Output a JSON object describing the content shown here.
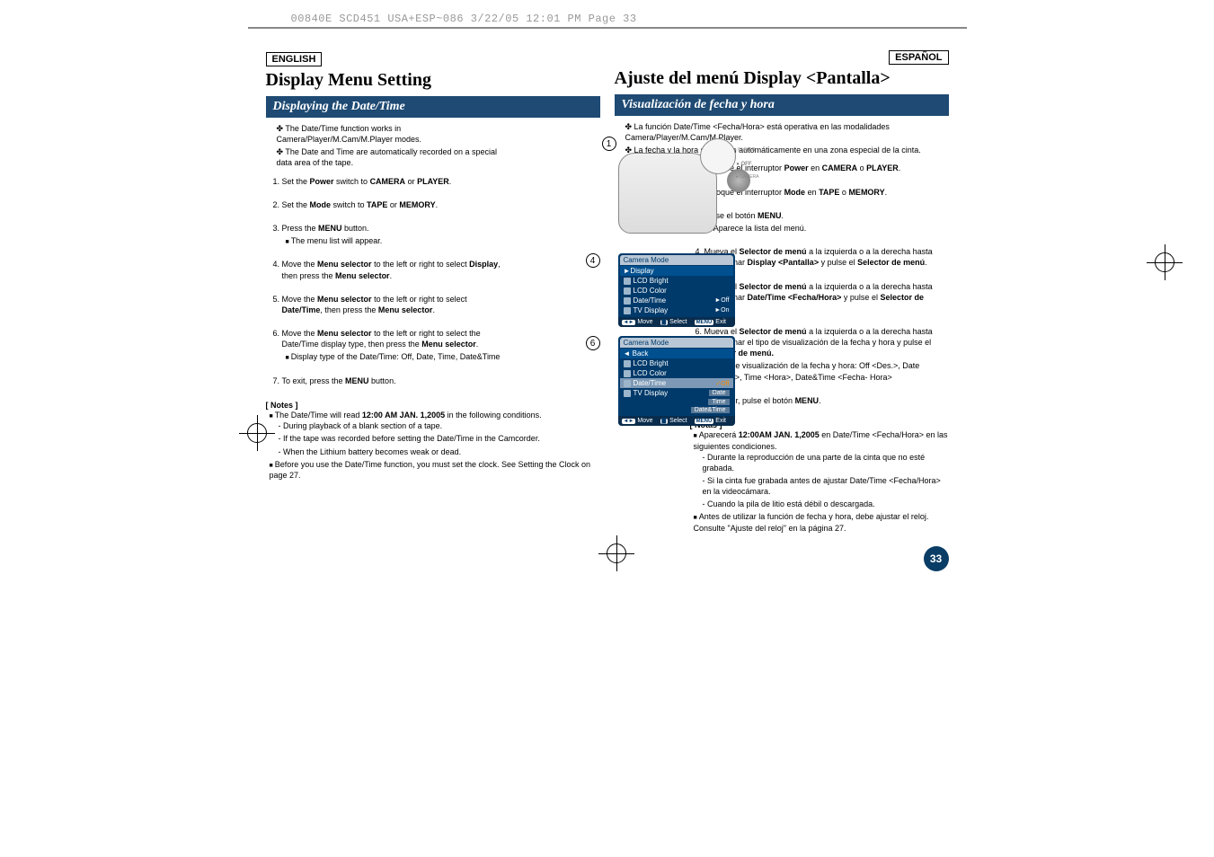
{
  "print_header": "00840E SCD451 USA+ESP~086  3/22/05 12:01 PM  Page 33",
  "left": {
    "lang": "ENGLISH",
    "title": "Display Menu Setting",
    "subtitle": "Displaying the Date/Time",
    "intro": [
      "The Date/Time function works in Camera/Player/M.Cam/M.Player modes.",
      "The Date and Time are automatically recorded on a special data area of the tape."
    ],
    "steps": [
      {
        "text": "Set the <strong>Power</strong> switch to <strong>CAMERA</strong> or <strong>PLAYER</strong>."
      },
      {
        "text": "Set the <strong>Mode</strong> switch to <strong>TAPE</strong> or <strong>MEMORY</strong>."
      },
      {
        "text": "Press the <strong>MENU</strong> button.",
        "subs": [
          "The menu list will appear."
        ]
      },
      {
        "text": "Move the <strong>Menu selector</strong> to the left or right to select <strong>Display</strong>, then press the <strong>Menu selector</strong>."
      },
      {
        "text": "Move the <strong>Menu selector</strong> to the left or right to select <strong>Date/Time</strong>, then press the <strong>Menu selector</strong>."
      },
      {
        "text": "Move the <strong>Menu selector</strong> to the left or right to select the Date/Time display type, then press the <strong>Menu selector</strong>.",
        "subs": [
          "Display type of the Date/Time: Off, Date, Time, Date&Time"
        ]
      },
      {
        "text": "To exit, press the <strong>MENU</strong> button."
      }
    ],
    "notes_head": "[ Notes ]",
    "notes": [
      {
        "text": "The Date/Time will read <strong>12:00 AM JAN. 1,2005</strong> in the following conditions.",
        "dashes": [
          "During playback of a blank section of a tape.",
          "If the tape was recorded before setting the Date/Time in the Camcorder.",
          "When the Lithium battery becomes weak or dead."
        ]
      },
      {
        "text": "Before you use the Date/Time function, you must set the clock. See Setting the Clock on page 27."
      }
    ]
  },
  "right": {
    "lang": "ESPAÑOL",
    "title": "Ajuste del menú Display <Pantalla>",
    "subtitle": "Visualización de fecha y hora",
    "intro": [
      "La función Date/Time <Fecha/Hora> está operativa en las modalidades Camera/Player/M.Cam/M.Player.",
      "La fecha y la hora se graban automáticamente en una zona especial de la cinta."
    ],
    "steps": [
      {
        "text": "Coloque el interruptor <strong>Power</strong> en <strong>CAMERA</strong> o <strong>PLAYER</strong>."
      },
      {
        "text": "Coloque el interruptor <strong>Mode</strong> en <strong>TAPE</strong> o <strong>MEMORY</strong>."
      },
      {
        "text": "Pulse el botón <strong>MENU</strong>.",
        "subs": [
          "Aparece la lista del menú."
        ]
      },
      {
        "text": "Mueva el <strong>Selector de menú</strong> a la izquierda o a la derecha hasta seleccionar <strong>Display &lt;Pantalla&gt;</strong> y pulse el <strong>Selector de menú</strong>."
      },
      {
        "text": "Mueva el <strong>Selector de menú</strong> a la izquierda o a la derecha hasta seleccionar <strong>Date/Time &lt;Fecha/Hora&gt;</strong> y pulse el <strong>Selector de menú</strong>."
      },
      {
        "text": "Mueva el <strong>Selector de menú</strong> a la izquierda o a la derecha hasta seleccionar el tipo de visualización de la fecha y hora y pulse el <strong>Selector de menú.</strong>",
        "subs": [
          "Tipo de visualización de la fecha y hora: Off <Des.>, Date <Fecha>, Time <Hora>, Date&Time <Fecha- Hora>"
        ]
      },
      {
        "text": "Para salir, pulse el botón <strong>MENU</strong>."
      }
    ],
    "notes_head": "[ Notas ]",
    "notes": [
      {
        "text": "Aparecerá <strong>12:00AM JAN. 1,2005</strong> en Date/Time &lt;Fecha/Hora&gt; en las siguientes condiciones.",
        "dashes": [
          "Durante la reproducción de una parte de la cinta que no esté grabada.",
          "Si la cinta fue grabada antes de ajustar Date/Time <Fecha/Hora> en la videocámara.",
          "Cuando la pila de litio está débil o descargada."
        ]
      },
      {
        "text": "Antes de utilizar la función de fecha y hora, debe ajustar el reloj. Consulte \"Ajuste del reloj\" en la página 27."
      }
    ]
  },
  "camera_labels": {
    "player": "PLAYER",
    "off": "OFF",
    "camera": "CAMERA"
  },
  "menu4": {
    "title": "Camera Mode",
    "back": "►Display",
    "rows": [
      "LCD Bright",
      "LCD Color",
      "Date/Time",
      "TV Display"
    ],
    "right": [
      "",
      "",
      "►Off",
      "►On"
    ]
  },
  "menu6": {
    "title": "Camera Mode",
    "back": "◄ Back",
    "rows": [
      "LCD Bright",
      "LCD Color",
      "Date/Time",
      "TV Display"
    ],
    "right": [
      "",
      "",
      "✓Off",
      ""
    ],
    "extras": [
      "Date",
      "Time",
      "Date&Time"
    ]
  },
  "footer": {
    "move": "Move",
    "select": "Select",
    "exit": "Exit"
  },
  "page_number": "33"
}
